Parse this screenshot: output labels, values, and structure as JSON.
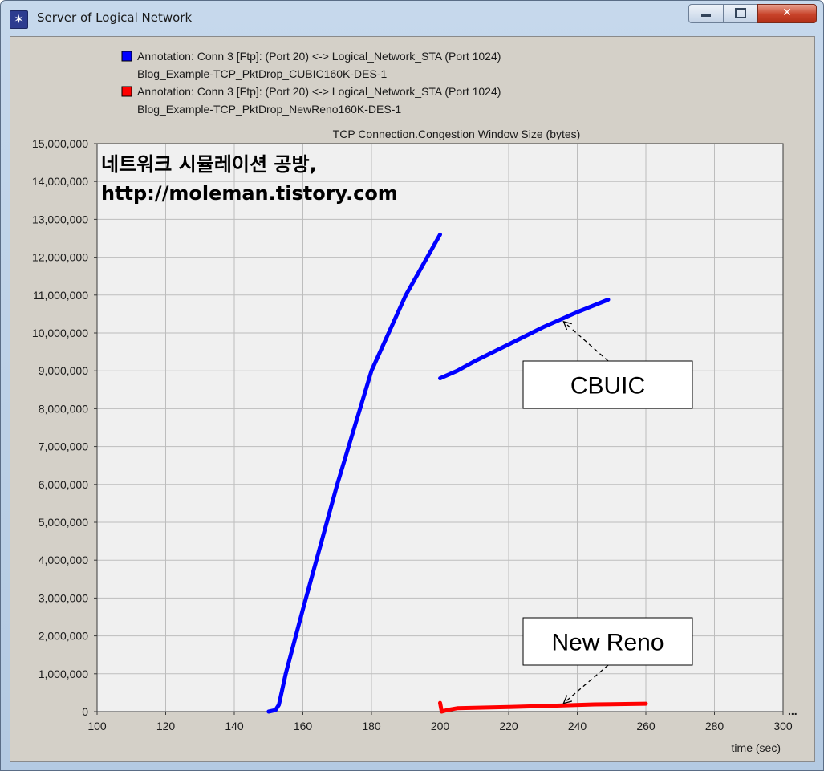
{
  "window": {
    "title": "Server of Logical Network",
    "icon": "star-burst-icon",
    "controls": {
      "minimize": "minimize-icon",
      "maximize": "maximize-icon",
      "close": "✕"
    }
  },
  "chart_data": {
    "type": "line",
    "title": "TCP Connection.Congestion Window Size (bytes)",
    "xlabel": "time (sec)",
    "ylabel": "",
    "xlim": [
      100,
      300
    ],
    "ylim": [
      0,
      15000000
    ],
    "x_ticks": [
      "100",
      "120",
      "140",
      "160",
      "180",
      "200",
      "220",
      "240",
      "260",
      "280",
      "300"
    ],
    "y_ticks": [
      "0",
      "1,000,000",
      "2,000,000",
      "3,000,000",
      "4,000,000",
      "5,000,000",
      "6,000,000",
      "7,000,000",
      "8,000,000",
      "9,000,000",
      "10,000,000",
      "11,000,000",
      "12,000,000",
      "13,000,000",
      "14,000,000",
      "15,000,000"
    ],
    "grid": true,
    "legend_position": "top-left",
    "legend": [
      {
        "line1": "Annotation: Conn 3 [Ftp]: (Port 20) <-> Logical_Network_STA (Port 1024)",
        "line2": "Blog_Example-TCP_PktDrop_CUBIC160K-DES-1",
        "color": "#0000ff"
      },
      {
        "line1": "Annotation: Conn 3 [Ftp]: (Port 20) <-> Logical_Network_STA (Port 1024)",
        "line2": "Blog_Example-TCP_PktDrop_NewReno160K-DES-1",
        "color": "#ff0000"
      }
    ],
    "series": [
      {
        "color": "#0000ff",
        "segments": [
          [
            [
              150,
              0
            ],
            [
              152,
              40000
            ],
            [
              153,
              180000
            ],
            [
              155,
              1000000
            ],
            [
              160,
              2700000
            ],
            [
              170,
              6000000
            ],
            [
              180,
              9000000
            ],
            [
              190,
              11000000
            ],
            [
              200,
              12600000
            ]
          ],
          [
            [
              200,
              8800000
            ],
            [
              205,
              9000000
            ],
            [
              210,
              9250000
            ],
            [
              220,
              9700000
            ],
            [
              230,
              10150000
            ],
            [
              240,
              10550000
            ],
            [
              249,
              10880000
            ]
          ]
        ]
      },
      {
        "color": "#ff0000",
        "segments": [
          [
            [
              200,
              230000
            ],
            [
              200.5,
              0
            ],
            [
              202,
              40000
            ],
            [
              205,
              90000
            ],
            [
              220,
              120000
            ],
            [
              235,
              160000
            ],
            [
              245,
              190000
            ],
            [
              260,
              210000
            ]
          ]
        ]
      }
    ],
    "annotations": {
      "watermark_line1": "네트워크 시뮬레이션 공방,",
      "watermark_line2": "http://moleman.tistory.com",
      "cubic_label": "CBUIC",
      "reno_label": "New Reno",
      "cubic_arrow_target": [
        236,
        10300000
      ],
      "reno_arrow_target": [
        236,
        220000
      ]
    },
    "overflow_marker": "..."
  }
}
